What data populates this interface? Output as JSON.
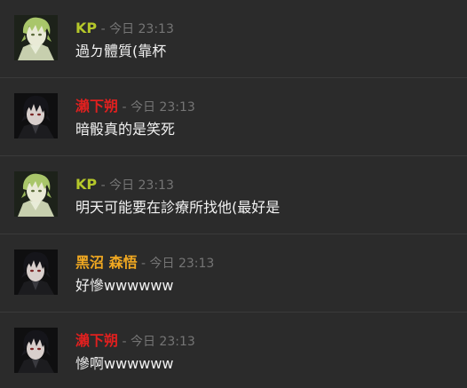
{
  "messages": [
    {
      "author": "KP",
      "author_color": "#b5c72a",
      "separator": " - ",
      "timestamp": "今日 23:13",
      "text": "過ㄉ體質(靠杯",
      "avatar": "green-haired-character-avatar"
    },
    {
      "author": "瀨下朔",
      "author_color": "#e0201f",
      "separator": " - ",
      "timestamp": "今日 23:13",
      "text": "暗骰真的是笑死",
      "avatar": "dark-haired-character-avatar"
    },
    {
      "author": "KP",
      "author_color": "#b5c72a",
      "separator": " - ",
      "timestamp": "今日 23:13",
      "text": "明天可能要在診療所找他(最好是",
      "avatar": "green-haired-character-avatar"
    },
    {
      "author": "黑沼 森悟",
      "author_color": "#f0a821",
      "separator": " - ",
      "timestamp": "今日 23:13",
      "text": "好慘wwwwww",
      "avatar": "dark-haired-character-avatar"
    },
    {
      "author": "瀨下朔",
      "author_color": "#e0201f",
      "separator": " - ",
      "timestamp": "今日 23:13",
      "text": "慘啊wwwwww",
      "avatar": "dark-haired-character-avatar"
    }
  ]
}
